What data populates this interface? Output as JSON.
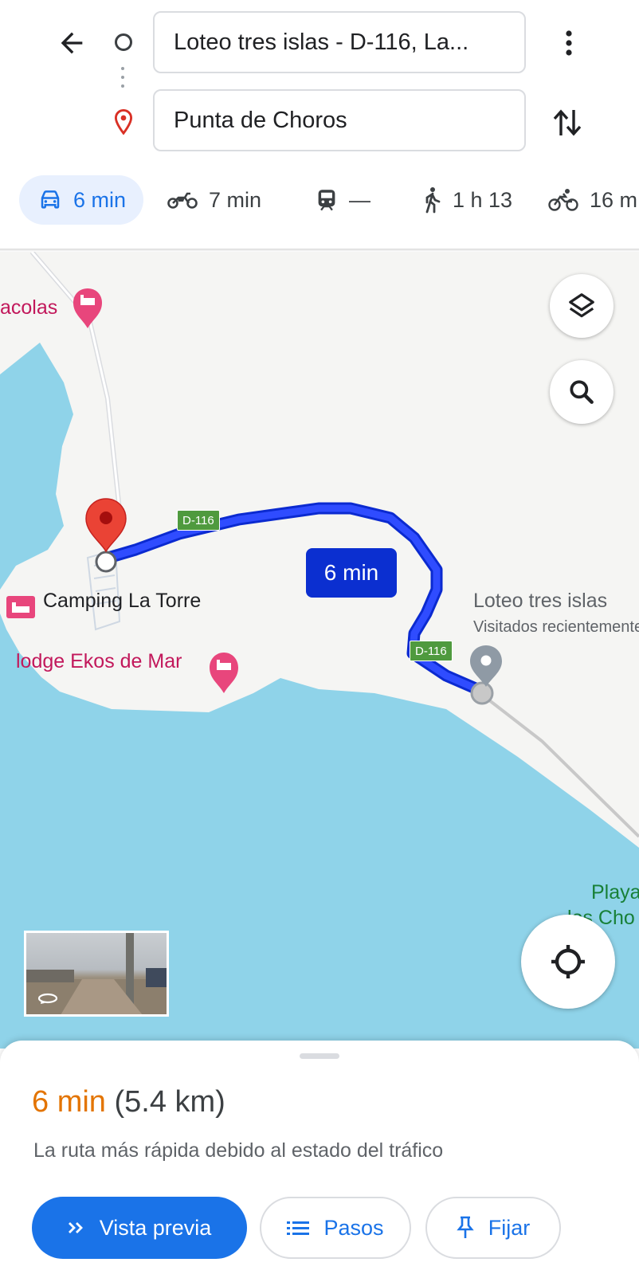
{
  "header": {
    "origin_value": "Loteo tres islas - D-116, La...",
    "destination_value": "Punta de Choros"
  },
  "modes": [
    {
      "name": "driving",
      "label": "6 min",
      "icon": "car-icon",
      "active": true
    },
    {
      "name": "motorcycle",
      "label": "7 min",
      "icon": "motorcycle-icon"
    },
    {
      "name": "transit",
      "label": "—",
      "icon": "train-icon"
    },
    {
      "name": "walking",
      "label": "1 h 13",
      "icon": "walking-icon"
    },
    {
      "name": "cycling",
      "label": "16 m",
      "icon": "bicycle-icon"
    }
  ],
  "map": {
    "route_duration_badge": "6 min",
    "road_shield_1": "D-116",
    "road_shield_2": "D-116",
    "poi": {
      "top_left_label": "acolas",
      "camping": "Camping La Torre",
      "lodge": "lodge Ekos de Mar",
      "origin_place": "Loteo tres islas",
      "origin_sub": "Visitados recientemente",
      "beach_line1": "Playa",
      "beach_line2": "los Cho"
    }
  },
  "route": {
    "eta": "6 min",
    "distance": "(5.4 km)",
    "description": "La ruta más rápida debido al estado del tráfico"
  },
  "actions": {
    "preview": "Vista previa",
    "steps": "Pasos",
    "pin": "Fijar"
  },
  "colors": {
    "route": "#1a3cf0",
    "accent": "#1a73e8",
    "eta": "#e37400",
    "water": "#8fd3e9",
    "land": "#f5f5f3",
    "destination_pin": "#ea4335",
    "hotel_pink": "#e8467c"
  }
}
